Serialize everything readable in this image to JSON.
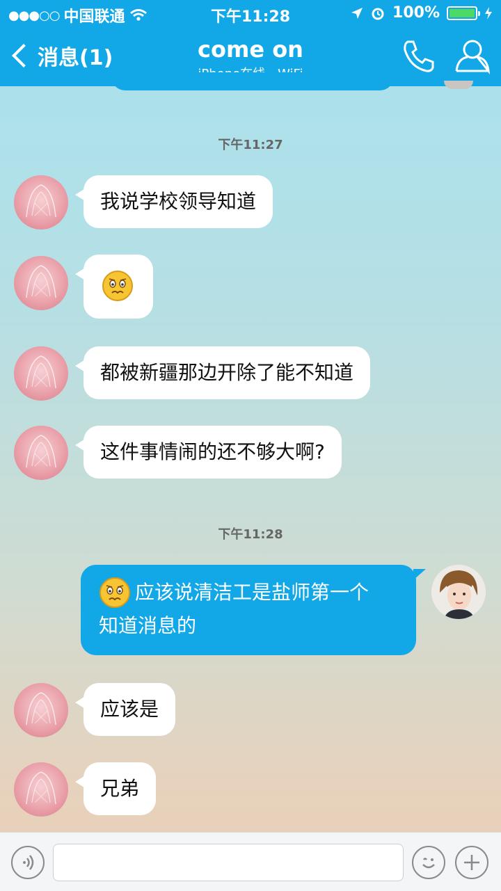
{
  "status_bar": {
    "carrier": "中国联通",
    "time": "下午11:28",
    "battery": "100%",
    "battery_level": 1.0,
    "signal_icon": "signal-dots-icon",
    "wifi_icon": "wifi-icon"
  },
  "header": {
    "back_label": "消息(1)",
    "title": "come on",
    "subtitle": "iPhone在线 - WiFi",
    "phone_icon": "phone-icon",
    "profile_icon": "profile-icon"
  },
  "messages": {
    "time1": "下午11:27",
    "m1": "我说学校领导知道",
    "m2_emoji": "worried-emoji",
    "m3": "都被新疆那边开除了能不知道",
    "m4": "这件事情闹的还不够大啊?",
    "time2": "下午11:28",
    "m5_line1": "应该说清洁工是盐师第一个",
    "m5_line2": "知道消息的",
    "m6": "应该是",
    "m7": "兄弟"
  },
  "input_bar": {
    "voice_icon": "voice-icon",
    "input_value": "",
    "emoji_icon": "emoji-icon",
    "plus_icon": "plus-icon"
  },
  "colors": {
    "accent": "#12a8e7",
    "incoming_bubble": "#ffffff",
    "outgoing_bubble": "#12a8e7"
  }
}
